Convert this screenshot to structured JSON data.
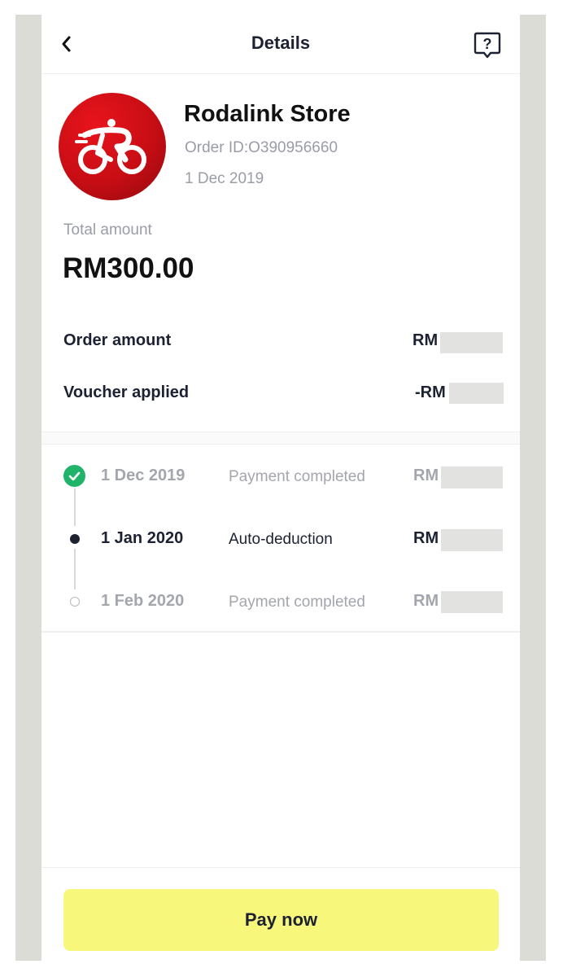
{
  "header": {
    "title": "Details",
    "back_icon": "chevron-left-icon",
    "help_icon": "help-question-icon"
  },
  "merchant": {
    "name": "Rodalink Store",
    "order_id": "Order ID:O390956660",
    "date": "1 Dec 2019",
    "logo_icon": "cyclist-logo-icon"
  },
  "total": {
    "label": "Total amount",
    "value": "RM300.00"
  },
  "breakdown": [
    {
      "label": "Order amount",
      "value": "RM"
    },
    {
      "label": "Voucher applied",
      "value": "-RM"
    }
  ],
  "schedule": [
    {
      "date": "1 Dec 2019",
      "status": "Payment completed",
      "amount": "RM",
      "state": "completed"
    },
    {
      "date": "1 Jan 2020",
      "status": "Auto-deduction",
      "amount": "RM",
      "state": "current"
    },
    {
      "date": "1 Feb 2020",
      "status": "Payment completed",
      "amount": "RM",
      "state": "upcoming"
    }
  ],
  "actions": {
    "pay_now": "Pay now"
  },
  "colors": {
    "accent_button": "#f6f77b",
    "success": "#22b36b",
    "brand_red": "#c80d14",
    "text_dark": "#1d2233",
    "text_muted": "#9a9da6"
  }
}
